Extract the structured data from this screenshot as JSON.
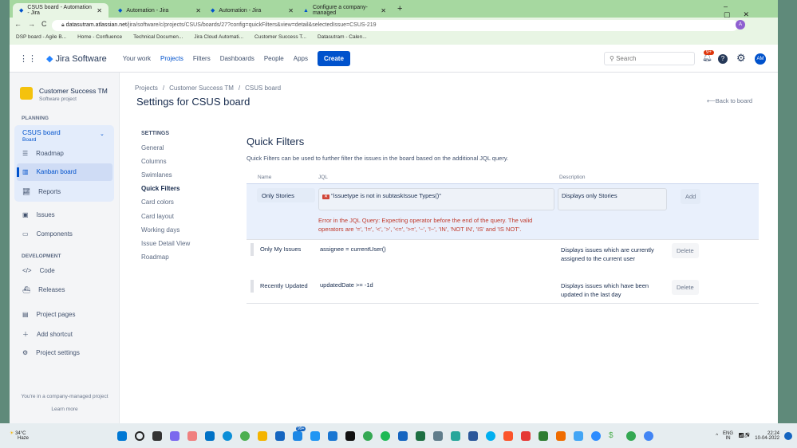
{
  "browser": {
    "tabs": [
      {
        "label": "CSUS board - Automation - Jira",
        "active": true
      },
      {
        "label": "Automation - Jira"
      },
      {
        "label": "Automation - Jira"
      },
      {
        "label": "Configure a company-managed"
      }
    ],
    "url_domain": "datasutram.atlassian.net",
    "url_path": "/jira/software/c/projects/CSUS/boards/27?config=quickFilters&view=detail&selectedIssue=CSUS-219",
    "bookmarks": [
      "DSP board - Agile B...",
      "Home - Confluence",
      "Technical Documen...",
      "Jira Cloud Automati...",
      "Customer Success T...",
      "Datasutram - Calen..."
    ]
  },
  "nav": {
    "logo": "Jira Software",
    "items": [
      "Your work",
      "Projects",
      "Filters",
      "Dashboards",
      "People",
      "Apps"
    ],
    "create": "Create",
    "search_placeholder": "Search",
    "notif_badge": "9+",
    "avatar": "AM"
  },
  "sidebar": {
    "project": "Customer Success TM",
    "project_type": "Software project",
    "planning": "PLANNING",
    "board": "CSUS board",
    "board_sub": "Board",
    "items": [
      "Roadmap",
      "Kanban board",
      "Reports",
      "Issues",
      "Components"
    ],
    "development": "DEVELOPMENT",
    "dev_items": [
      "Code",
      "Releases"
    ],
    "bottom": [
      "Project pages",
      "Add shortcut",
      "Project settings"
    ],
    "footer": "You're in a company-managed project",
    "learn_more": "Learn more"
  },
  "main": {
    "breadcrumbs": [
      "Projects",
      "Customer Success TM",
      "CSUS board"
    ],
    "title": "Settings for CSUS board",
    "back": "Back to board",
    "settings_heading": "SETTINGS",
    "settings_items": [
      "General",
      "Columns",
      "Swimlanes",
      "Quick Filters",
      "Card colors",
      "Card layout",
      "Working days",
      "Issue Detail View",
      "Roadmap"
    ],
    "qf_title": "Quick Filters",
    "qf_desc": "Quick Filters can be used to further filter the issues in the board based on the additional JQL query.",
    "cols": [
      "Name",
      "JQL",
      "Description"
    ],
    "new": {
      "name": "Only Stories",
      "jql": "\"issuetype is not in subtaskIssue Types()\"",
      "desc": "Displays only Stories",
      "add": "Add",
      "error": "Error in the JQL Query: Expecting operator before the end of the query. The valid operators are '=', '!=', '<', '>', '<=', '>=', '~', '!~', 'IN', 'NOT IN', 'IS' and 'IS NOT'."
    },
    "rows": [
      {
        "name": "Only My Issues",
        "jql": "assignee = currentUser()",
        "desc": "Displays issues which are currently assigned to the current user",
        "action": "Delete"
      },
      {
        "name": "Recently Updated",
        "jql": "updatedDate >= -1d",
        "desc": "Displays issues which have been updated in the last day",
        "action": "Delete"
      }
    ]
  },
  "taskbar": {
    "temp": "34°C",
    "weather": "Haze",
    "lang": "ENG",
    "region": "IN",
    "time": "22:24",
    "date": "10-04-2022",
    "badge": "99+"
  }
}
